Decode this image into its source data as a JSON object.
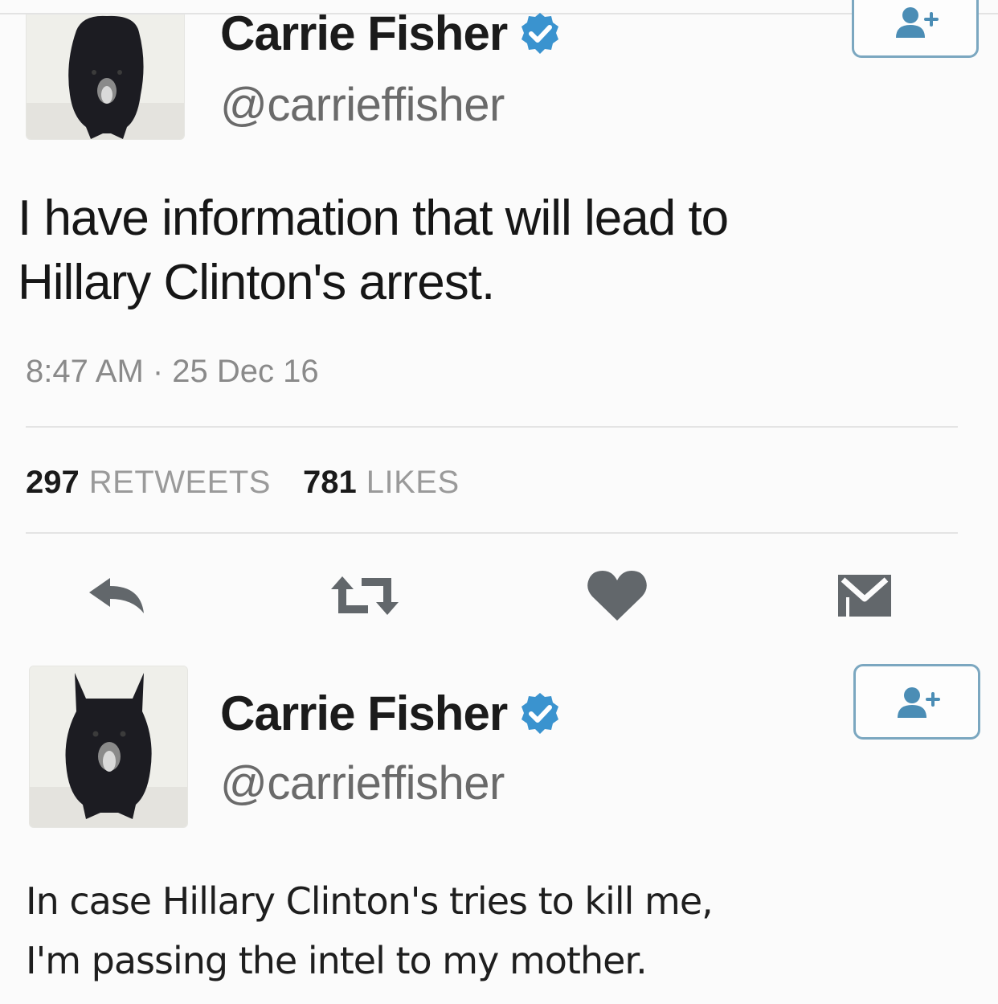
{
  "tweets": [
    {
      "display_name": "Carrie Fisher",
      "handle": "@carrieffisher",
      "text": "I have information that will lead to\nHillary Clinton's arrest.",
      "timestamp": "8:47 AM · 25 Dec 16",
      "retweets_count": "297",
      "retweets_label": "RETWEETS",
      "likes_count": "781",
      "likes_label": "LIKES"
    },
    {
      "display_name": "Carrie Fisher",
      "handle": "@carrieffisher",
      "text": "In case Hillary Clinton's tries to kill me,\n I'm passing the intel to my mother."
    }
  ],
  "icons": {
    "verified": "verified-badge-icon",
    "follow": "add-user-icon",
    "reply": "reply-icon",
    "retweet": "retweet-icon",
    "like": "heart-icon",
    "dm": "envelope-icon"
  },
  "colors": {
    "verified_blue": "#3a93cf",
    "follow_border": "#7ba7c0",
    "action_gray": "#62676b",
    "muted_text": "#8a8a8a"
  }
}
